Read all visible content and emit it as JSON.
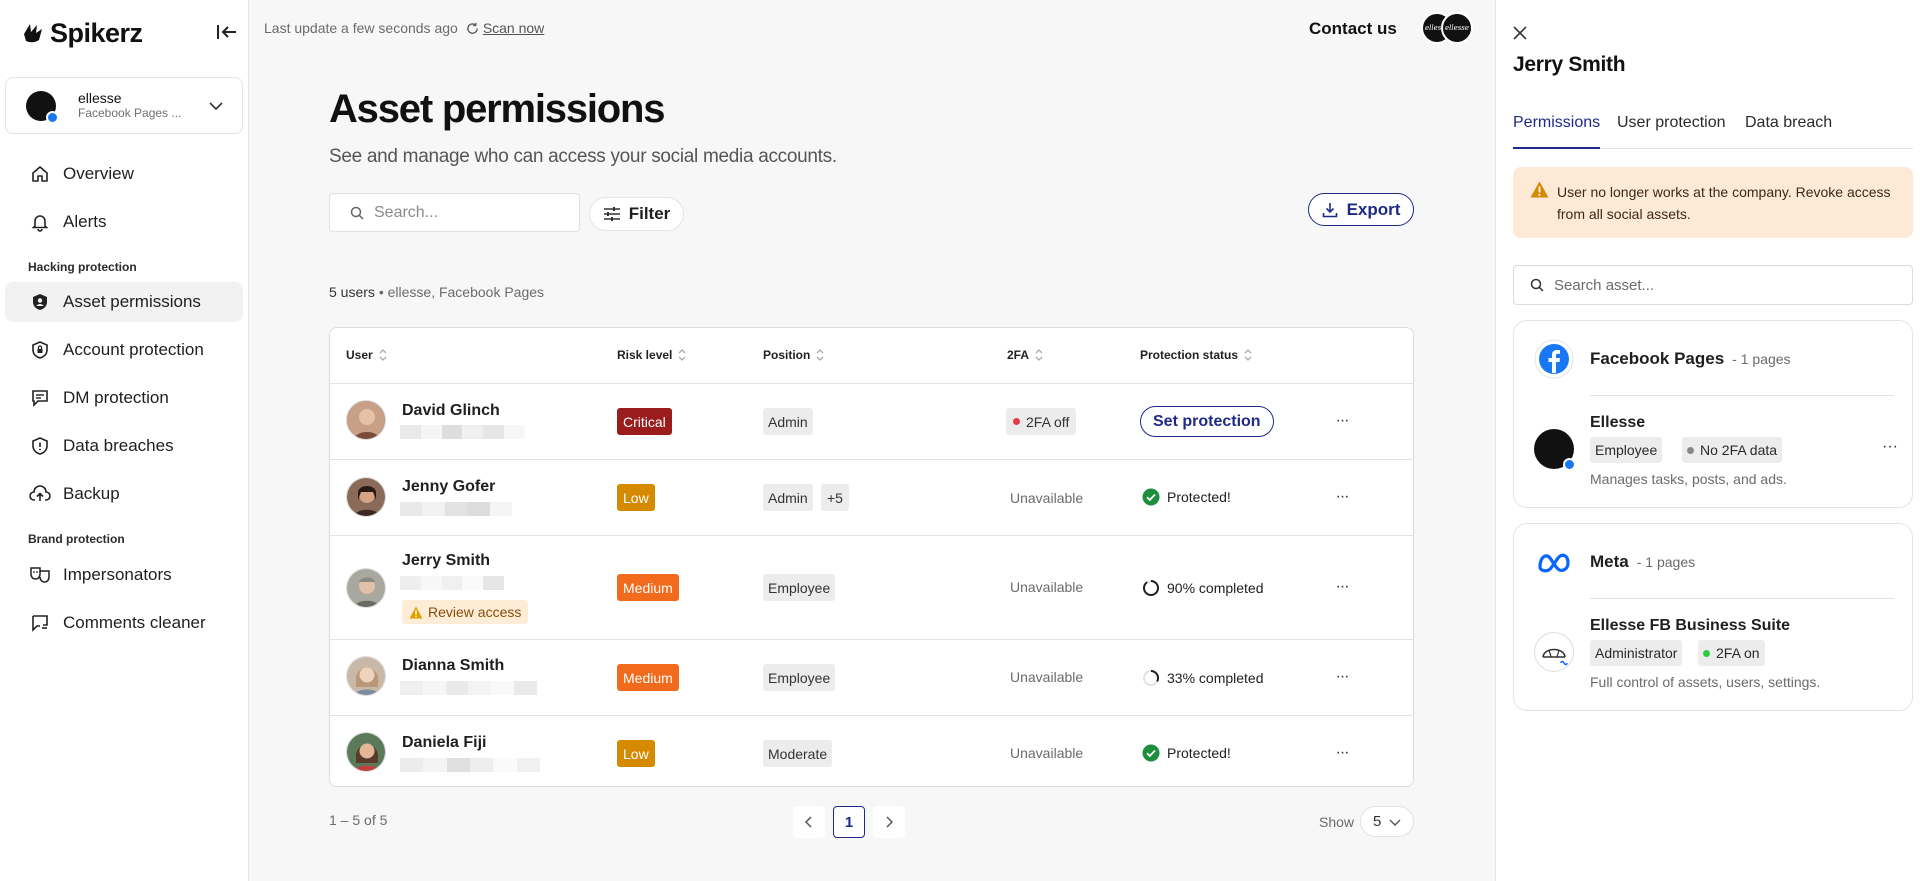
{
  "app": {
    "brand": "Spikerz"
  },
  "account": {
    "name": "ellesse",
    "subtitle": "Facebook Pages ..."
  },
  "nav": {
    "overview": "Overview",
    "alerts": "Alerts",
    "section_hacking": "Hacking protection",
    "asset_permissions": "Asset permissions",
    "account_protection": "Account protection",
    "dm_protection": "DM protection",
    "data_breaches": "Data breaches",
    "backup": "Backup",
    "section_brand": "Brand protection",
    "impersonators": "Impersonators",
    "comments_cleaner": "Comments cleaner"
  },
  "topbar": {
    "last_update": "Last update a few seconds ago",
    "scan_now": "Scan now",
    "contact": "Contact us",
    "avatar_text": "ellesse"
  },
  "page": {
    "title": "Asset permissions",
    "subtitle": "See and manage who can access your social media accounts.",
    "search_placeholder": "Search...",
    "filter_label": "Filter",
    "export_label": "Export",
    "users_count": "5 users",
    "users_context": "ellesse, Facebook Pages"
  },
  "table": {
    "headers": {
      "user": "User",
      "risk": "Risk level",
      "position": "Position",
      "twofa": "2FA",
      "protection": "Protection status"
    },
    "rows": [
      {
        "name": "David Glinch",
        "risk": "Critical",
        "risk_color": "#9b1c1c",
        "position": "Admin",
        "twofa": "2FA off",
        "action": "Set protection"
      },
      {
        "name": "Jenny Gofer",
        "risk": "Low",
        "risk_color": "#d68a00",
        "position": "Admin",
        "position_more": "+5",
        "twofa": "Unavailable",
        "status": "Protected!"
      },
      {
        "name": "Jerry Smith",
        "risk": "Medium",
        "risk_color": "#f26a1b",
        "position": "Employee",
        "twofa": "Unavailable",
        "status": "90% completed",
        "progress": 0.9,
        "review": "Review access"
      },
      {
        "name": "Dianna Smith",
        "risk": "Medium",
        "risk_color": "#f26a1b",
        "position": "Employee",
        "twofa": "Unavailable",
        "status": "33% completed",
        "progress": 0.33
      },
      {
        "name": "Daniela Fiji",
        "risk": "Low",
        "risk_color": "#d68a00",
        "position": "Moderate",
        "twofa": "Unavailable",
        "status": "Protected!"
      }
    ]
  },
  "pagination": {
    "range": "1 – 5 of 5",
    "current": "1",
    "show_label": "Show",
    "show_value": "5"
  },
  "panel": {
    "title": "Jerry Smith",
    "tabs": [
      "Permissions",
      "User protection",
      "Data breach"
    ],
    "warning": "User no longer works at the company. Revoke access from all social assets.",
    "search_placeholder": "Search asset...",
    "groups": [
      {
        "platform": "Facebook Pages",
        "count": "1 pages",
        "item": {
          "name": "Ellesse",
          "role": "Employee",
          "twofa": "No 2FA data",
          "desc": "Manages tasks, posts, and ads."
        }
      },
      {
        "platform": "Meta",
        "count": "1 pages",
        "item": {
          "name": "Ellesse FB Business Suite",
          "role": "Administrator",
          "twofa": "2FA on",
          "desc": "Full control of assets, users, settings."
        }
      }
    ]
  },
  "colors": {
    "accent": "#1f2a86",
    "critical": "#9b1c1c",
    "low": "#d68a00",
    "medium": "#f26a1b",
    "protected": "#1e8e3e",
    "warning_bg": "#fde9d6"
  }
}
